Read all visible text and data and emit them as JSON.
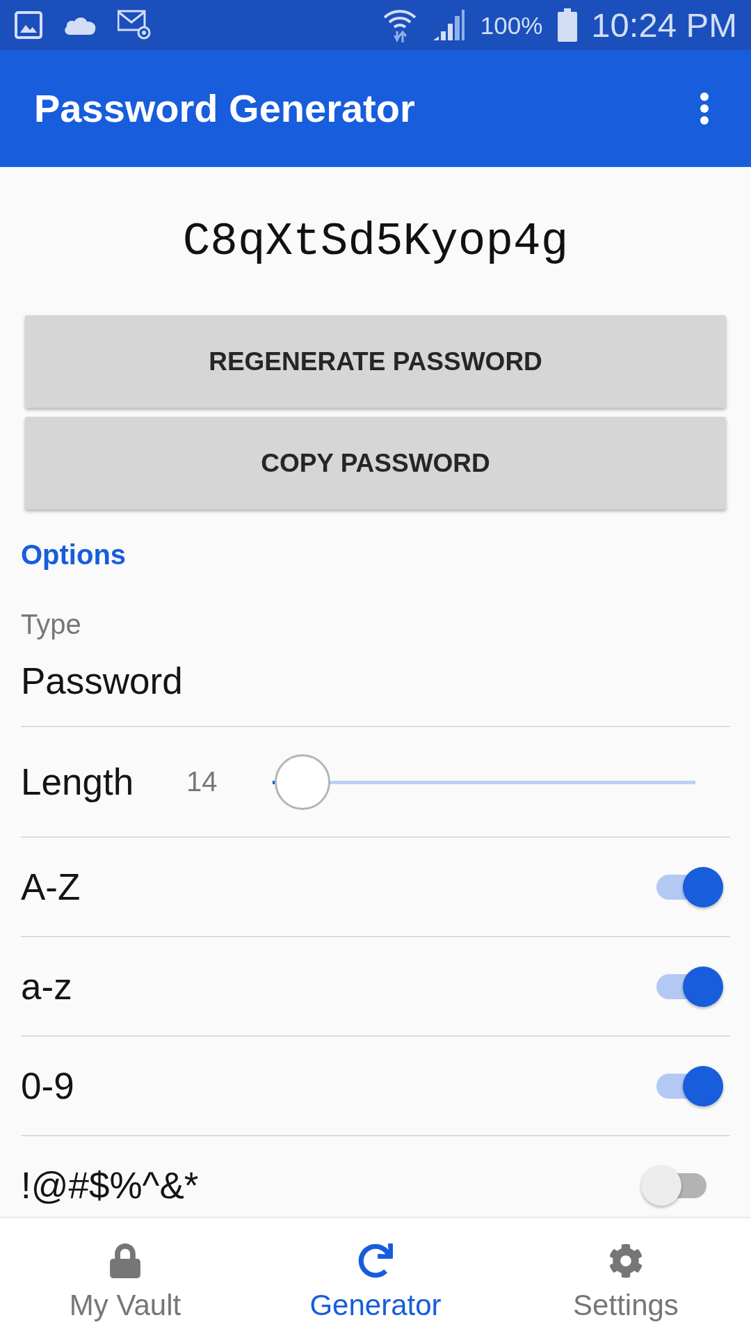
{
  "status_bar": {
    "battery": "100%",
    "time": "10:24 PM"
  },
  "app_bar": {
    "title": "Password Generator"
  },
  "password": "C8qXtSd5Kyop4g",
  "buttons": [
    {
      "label": "REGENERATE PASSWORD"
    },
    {
      "label": "COPY PASSWORD"
    }
  ],
  "options": {
    "heading": "Options",
    "type": {
      "label": "Type",
      "value": "Password"
    },
    "length": {
      "label": "Length",
      "value": "14",
      "level": 0.07
    },
    "toggles": [
      {
        "label": "A-Z",
        "on": true
      },
      {
        "label": "a-z",
        "on": true
      },
      {
        "label": "0-9",
        "on": true
      },
      {
        "label": "!@#$%^&*",
        "on": false
      }
    ]
  },
  "bottom_nav": [
    {
      "kind": "lock",
      "label": "My Vault",
      "selected": false
    },
    {
      "kind": "generator",
      "label": "Generator",
      "selected": true
    },
    {
      "kind": "settings",
      "label": "Settings",
      "selected": false
    }
  ]
}
